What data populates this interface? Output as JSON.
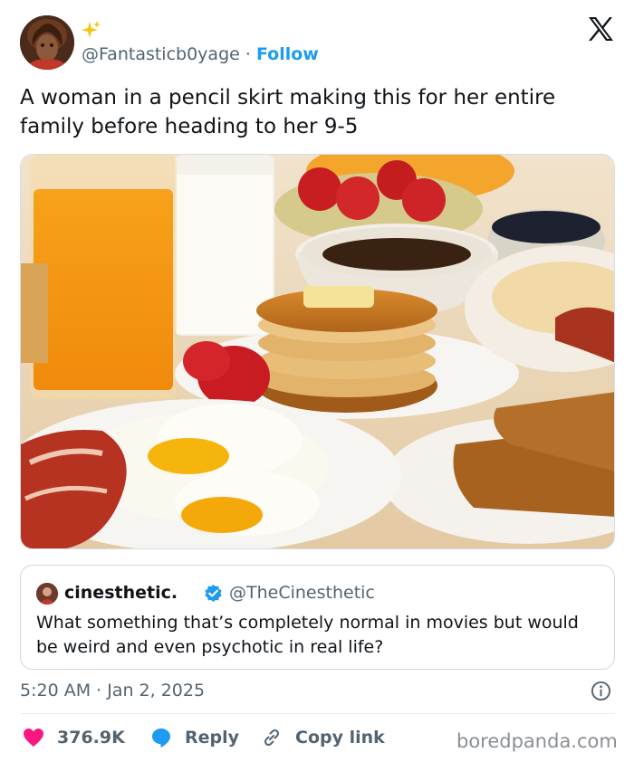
{
  "author": {
    "handle": "@Fantasticb0yage",
    "separator": "·",
    "follow_label": "Follow",
    "sparkle_icon": "sparkles-icon"
  },
  "tweet": {
    "text": "A woman in a pencil skirt making this for her entire family before heading to her 9-5",
    "photo_icon": "breakfast-photo"
  },
  "quote": {
    "name": "cinesthetic.",
    "handle": "@TheCinesthetic",
    "text": "What something that’s completely normal in movies but would be weird and even psychotic in real life?"
  },
  "meta": {
    "timestamp": "5:20 AM · Jan 2, 2025"
  },
  "actions": {
    "likes": "376.9K",
    "reply_label": "Reply",
    "copy_label": "Copy link"
  },
  "watermark": "boredpanda.com",
  "colors": {
    "accent": "#1d9bf0",
    "like": "#f91880",
    "muted": "#536471"
  }
}
